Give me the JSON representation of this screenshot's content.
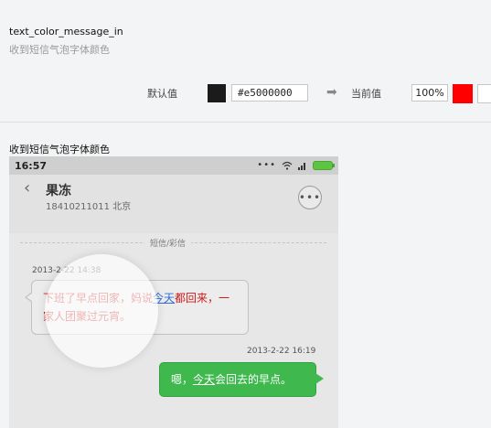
{
  "resource": {
    "key": "text_color_message_in",
    "description": "收到短信气泡字体颜色"
  },
  "editor": {
    "default_label": "默认值",
    "default_color": "#1b1b1b",
    "default_hex": "#e5000000",
    "arrow_icon": "right-arrow-icon",
    "current_label": "当前值",
    "current_alpha": "100%",
    "current_color": "#ff0000"
  },
  "preview": {
    "title": "收到短信气泡字体颜色",
    "status_time": "16:57",
    "contact_name": "果冻",
    "contact_number": "18410211011 北京",
    "separator_label": "短信/彩信",
    "incoming": {
      "timestamp": "2013-2-22 14:38",
      "text_before_link": "下班了早点回家，妈说",
      "link_text": "今天",
      "text_after_link": "都回来，一家人团聚过元宵。",
      "text_color": "#cc1b1b"
    },
    "outgoing": {
      "timestamp": "2013-2-22 16:19",
      "text_before_link": "嗯，",
      "link_text": "今天",
      "text_after_link": "会回去的早点。",
      "bubble_color": "#3fb84d"
    }
  }
}
